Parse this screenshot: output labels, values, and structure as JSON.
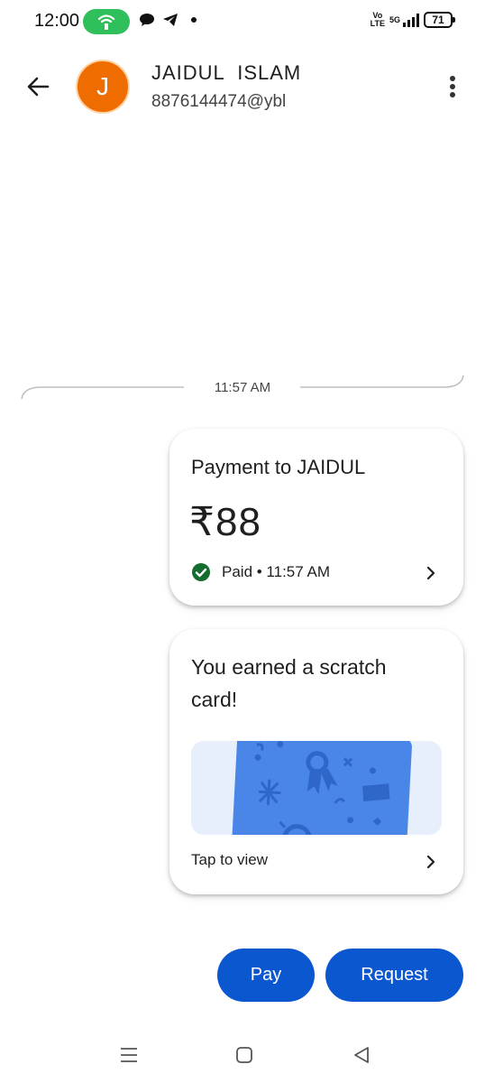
{
  "status_bar": {
    "time": "12:00",
    "battery": "71",
    "network": "5G",
    "volte": "Vo LTE"
  },
  "header": {
    "avatar_initial": "J",
    "name": "JAIDUL  ISLAM",
    "upi_id": "8876144474@ybl"
  },
  "conversation": {
    "timestamp": "11:57 AM"
  },
  "payment_card": {
    "title": "Payment to JAIDUL",
    "amount": "₹88",
    "status": "Paid • 11:57 AM"
  },
  "scratch_card": {
    "title": "You earned a scratch card!",
    "action": "Tap to view"
  },
  "actions": {
    "pay_label": "Pay",
    "request_label": "Request"
  },
  "colors": {
    "accent": "#0b57d0",
    "avatar": "#ef6c00",
    "success": "#146c2e",
    "hotspot": "#2fbf5b",
    "scratch_card": "#4a86e8"
  },
  "icons": {
    "back": "arrow-left-icon",
    "more": "more-vertical-icon",
    "paid": "check-circle-icon",
    "chevron": "chevron-right-icon",
    "nav": [
      "menu-icon",
      "home-square-icon",
      "back-triangle-icon"
    ]
  }
}
